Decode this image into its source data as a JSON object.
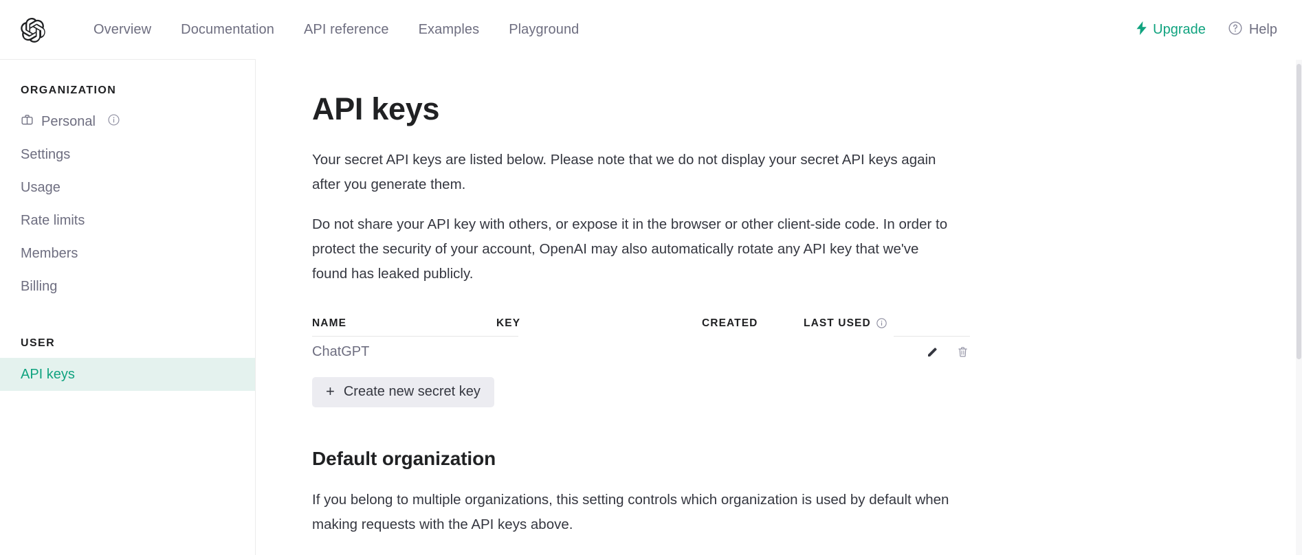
{
  "colors": {
    "accent_green": "#10a37f",
    "active_nav_bg": "#e4f2ee",
    "text_primary": "#202123",
    "text_secondary": "#6e6e80",
    "button_bg": "#ececf1"
  },
  "topnav": {
    "logo_name": "openai-logo",
    "links": [
      {
        "label": "Overview"
      },
      {
        "label": "Documentation"
      },
      {
        "label": "API reference"
      },
      {
        "label": "Examples"
      },
      {
        "label": "Playground"
      }
    ],
    "upgrade": {
      "label": "Upgrade",
      "icon": "lightning-bolt-icon"
    },
    "help": {
      "label": "Help",
      "icon": "question-circle-icon"
    }
  },
  "sidebar": {
    "organization": {
      "title": "ORGANIZATION",
      "items": [
        {
          "label": "Personal",
          "icon": "briefcase-icon",
          "trailing_icon": "info-circle-icon",
          "active": false
        },
        {
          "label": "Settings",
          "active": false
        },
        {
          "label": "Usage",
          "active": false
        },
        {
          "label": "Rate limits",
          "active": false
        },
        {
          "label": "Members",
          "active": false
        },
        {
          "label": "Billing",
          "active": false
        }
      ]
    },
    "user": {
      "title": "USER",
      "items": [
        {
          "label": "API keys",
          "active": true
        }
      ]
    }
  },
  "main": {
    "title": "API keys",
    "paragraph_1": "Your secret API keys are listed below. Please note that we do not display your secret API keys again after you generate them.",
    "paragraph_2": "Do not share your API key with others, or expose it in the browser or other client-side code. In order to protect the security of your account, OpenAI may also automatically rotate any API key that we've found has leaked publicly.",
    "table": {
      "headers": {
        "name": "NAME",
        "key": "KEY",
        "created": "CREATED",
        "last_used": "LAST USED",
        "last_used_icon": "info-circle-icon"
      },
      "rows": [
        {
          "name": "ChatGPT",
          "key": "",
          "created": "",
          "last_used": "",
          "edit_icon": "pencil-icon",
          "delete_icon": "trash-icon"
        }
      ]
    },
    "create_button": {
      "label": "Create new secret key",
      "icon": "plus-icon"
    },
    "default_org": {
      "title": "Default organization",
      "paragraph": "If you belong to multiple organizations, this setting controls which organization is used by default when making requests with the API keys above."
    }
  }
}
